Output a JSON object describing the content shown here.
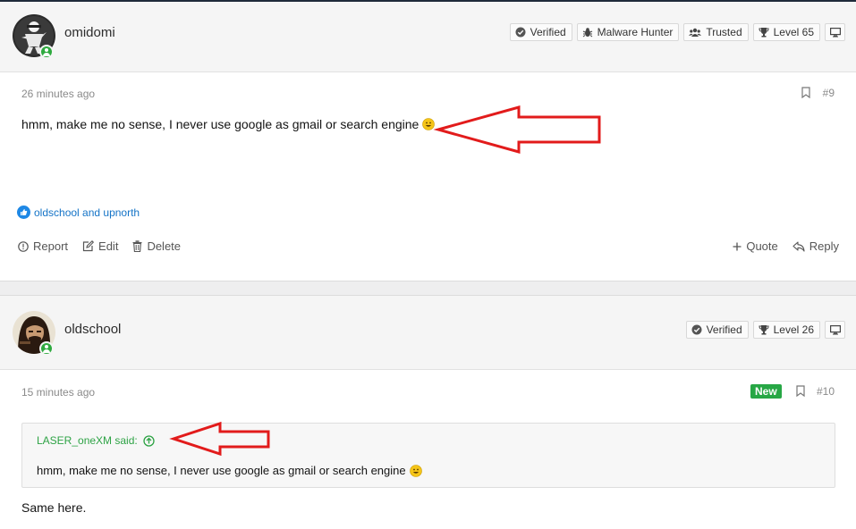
{
  "post9": {
    "username": "omidomi",
    "badges": {
      "verified": "Verified",
      "malware_hunter": "Malware Hunter",
      "trusted": "Trusted",
      "level": "Level 65"
    },
    "time": "26 minutes ago",
    "number": "#9",
    "message": "hmm, make me no sense, I never use google as gmail or search engine",
    "reactions": "oldschool and upnorth",
    "actions": {
      "report": "Report",
      "edit": "Edit",
      "delete": "Delete",
      "quote": "Quote",
      "reply": "Reply"
    }
  },
  "post10": {
    "username": "oldschool",
    "badges": {
      "verified": "Verified",
      "level": "Level 26"
    },
    "time": "15 minutes ago",
    "new_label": "New",
    "number": "#10",
    "quote_author": "LASER_oneXM said:",
    "quote_text": "hmm, make me no sense, I never use google as gmail or search engine",
    "message": "Same here."
  },
  "colors": {
    "accent_green": "#27a745",
    "link_blue": "#1574c7",
    "arrow_red": "#e21b1b"
  }
}
